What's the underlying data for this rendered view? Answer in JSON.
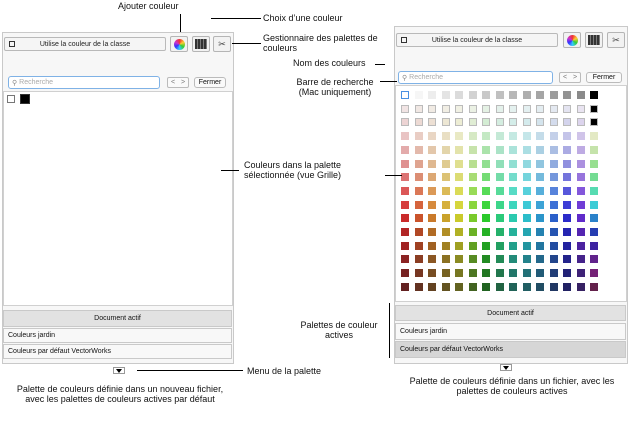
{
  "left_panel": {
    "class_button_label": "Utilise la couleur de la classe",
    "search_placeholder": "Recherche",
    "close_label": "Fermer",
    "nav_prev": "<",
    "nav_next": ">",
    "swatches": [
      "#ffffff",
      "#000000"
    ],
    "palettes": [
      {
        "label": "Document actif",
        "active": true
      },
      {
        "label": "Couleurs jardin",
        "active": false
      },
      {
        "label": "Couleurs par défaut VectorWorks",
        "active": false
      }
    ]
  },
  "right_panel": {
    "class_button_label": "Utilise la couleur de la classe",
    "search_placeholder": "Recherche",
    "close_label": "Fermer",
    "nav_prev": "<",
    "nav_next": ">",
    "palettes": [
      {
        "label": "Document actif",
        "active": true
      },
      {
        "label": "Couleurs jardin",
        "active": false
      },
      {
        "label": "Couleurs par défaut VectorWorks",
        "active": true
      }
    ]
  },
  "annotations": {
    "add_color": "Ajouter couleur",
    "choose_color": "Choix d’une couleur",
    "palette_manager": "Gestionnaire des palettes de couleurs",
    "color_names": "Nom des couleurs",
    "search_bar": "Barre de recherche (Mac uniquement)",
    "palette_colors": "Couleurs dans la palette sélectionnée (vue Grille)",
    "active_palettes": "Palettes de couleur actives",
    "palette_menu": "Menu de la palette",
    "left_caption": "Palette de couleurs définie dans un nouveau fichier, avec les palettes de couleurs actives par défaut",
    "right_caption": "Palette de couleurs définie dans un fichier, avec les palettes de couleurs actives"
  },
  "icons": [
    "color-wheel-icon",
    "palette-grid-icon",
    "palette-manager-icon",
    "search-icon",
    "popout-icon",
    "menu-arrow-icon"
  ]
}
